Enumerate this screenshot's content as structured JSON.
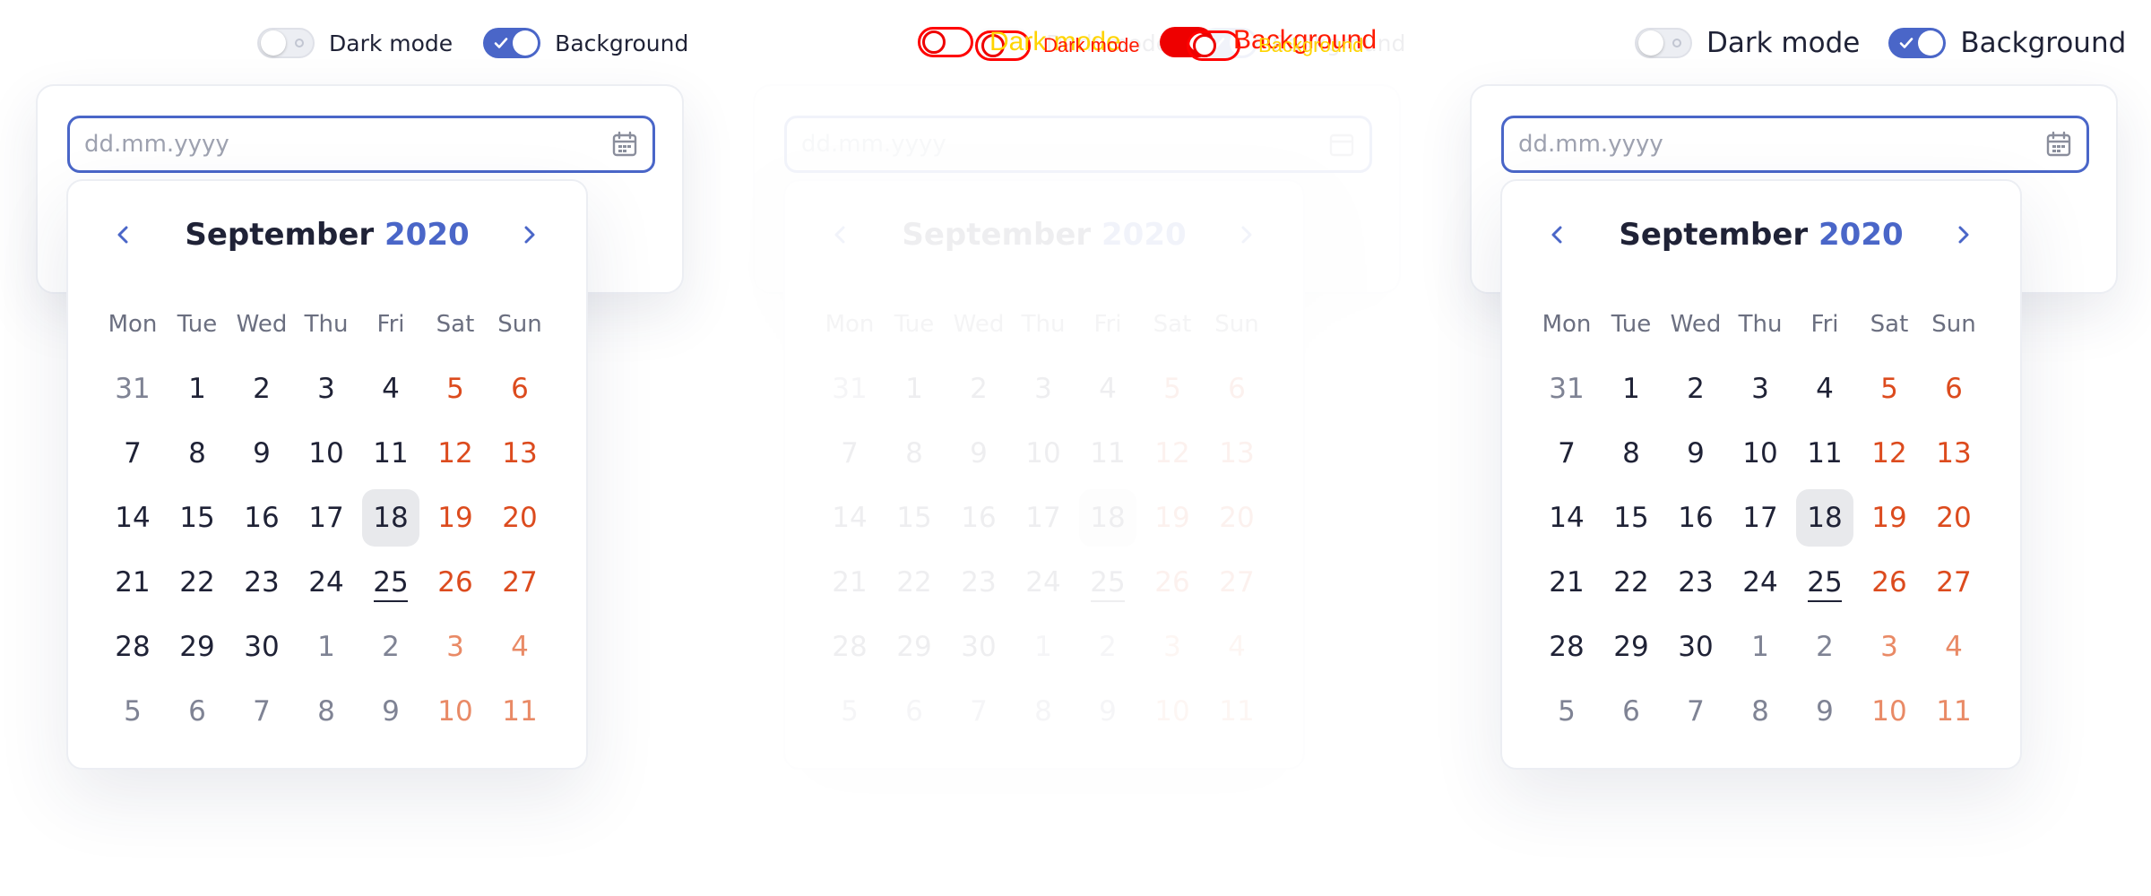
{
  "toggles": {
    "dark_mode_label": "Dark mode",
    "background_label": "Background",
    "dark_mode_on": false,
    "background_on": true
  },
  "date_input": {
    "placeholder": "dd.mm.yyyy"
  },
  "calendar": {
    "month": "September",
    "year": "2020",
    "weekdays": [
      "Mon",
      "Tue",
      "Wed",
      "Thu",
      "Fri",
      "Sat",
      "Sun"
    ],
    "selected_day": "18",
    "today_day": "25",
    "weeks": [
      [
        {
          "d": "31",
          "m": true
        },
        {
          "d": "1"
        },
        {
          "d": "2"
        },
        {
          "d": "3"
        },
        {
          "d": "4"
        },
        {
          "d": "5",
          "w": true
        },
        {
          "d": "6",
          "w": true
        }
      ],
      [
        {
          "d": "7"
        },
        {
          "d": "8"
        },
        {
          "d": "9"
        },
        {
          "d": "10"
        },
        {
          "d": "11"
        },
        {
          "d": "12",
          "w": true
        },
        {
          "d": "13",
          "w": true
        }
      ],
      [
        {
          "d": "14"
        },
        {
          "d": "15"
        },
        {
          "d": "16"
        },
        {
          "d": "17"
        },
        {
          "d": "18",
          "s": true
        },
        {
          "d": "19",
          "w": true
        },
        {
          "d": "20",
          "w": true
        }
      ],
      [
        {
          "d": "21"
        },
        {
          "d": "22"
        },
        {
          "d": "23"
        },
        {
          "d": "24"
        },
        {
          "d": "25",
          "t": true
        },
        {
          "d": "26",
          "w": true
        },
        {
          "d": "27",
          "w": true
        }
      ],
      [
        {
          "d": "28"
        },
        {
          "d": "29"
        },
        {
          "d": "30"
        },
        {
          "d": "1",
          "m": true
        },
        {
          "d": "2",
          "m": true
        },
        {
          "d": "3",
          "m": true,
          "w": true
        },
        {
          "d": "4",
          "m": true,
          "w": true
        }
      ],
      [
        {
          "d": "5",
          "m": true
        },
        {
          "d": "6",
          "m": true
        },
        {
          "d": "7",
          "m": true
        },
        {
          "d": "8",
          "m": true
        },
        {
          "d": "9",
          "m": true
        },
        {
          "d": "10",
          "m": true,
          "w": true
        },
        {
          "d": "11",
          "m": true,
          "w": true
        }
      ]
    ]
  },
  "colors": {
    "accent": "#4a66c8",
    "weekend": "#dc4b1e",
    "text": "#1f2236",
    "glitch_red": "#ff0000",
    "glitch_yellow": "#ffd400"
  },
  "icons": {
    "calendar": "calendar-icon",
    "prev": "chevron-left-icon",
    "next": "chevron-right-icon",
    "check": "check-icon"
  }
}
